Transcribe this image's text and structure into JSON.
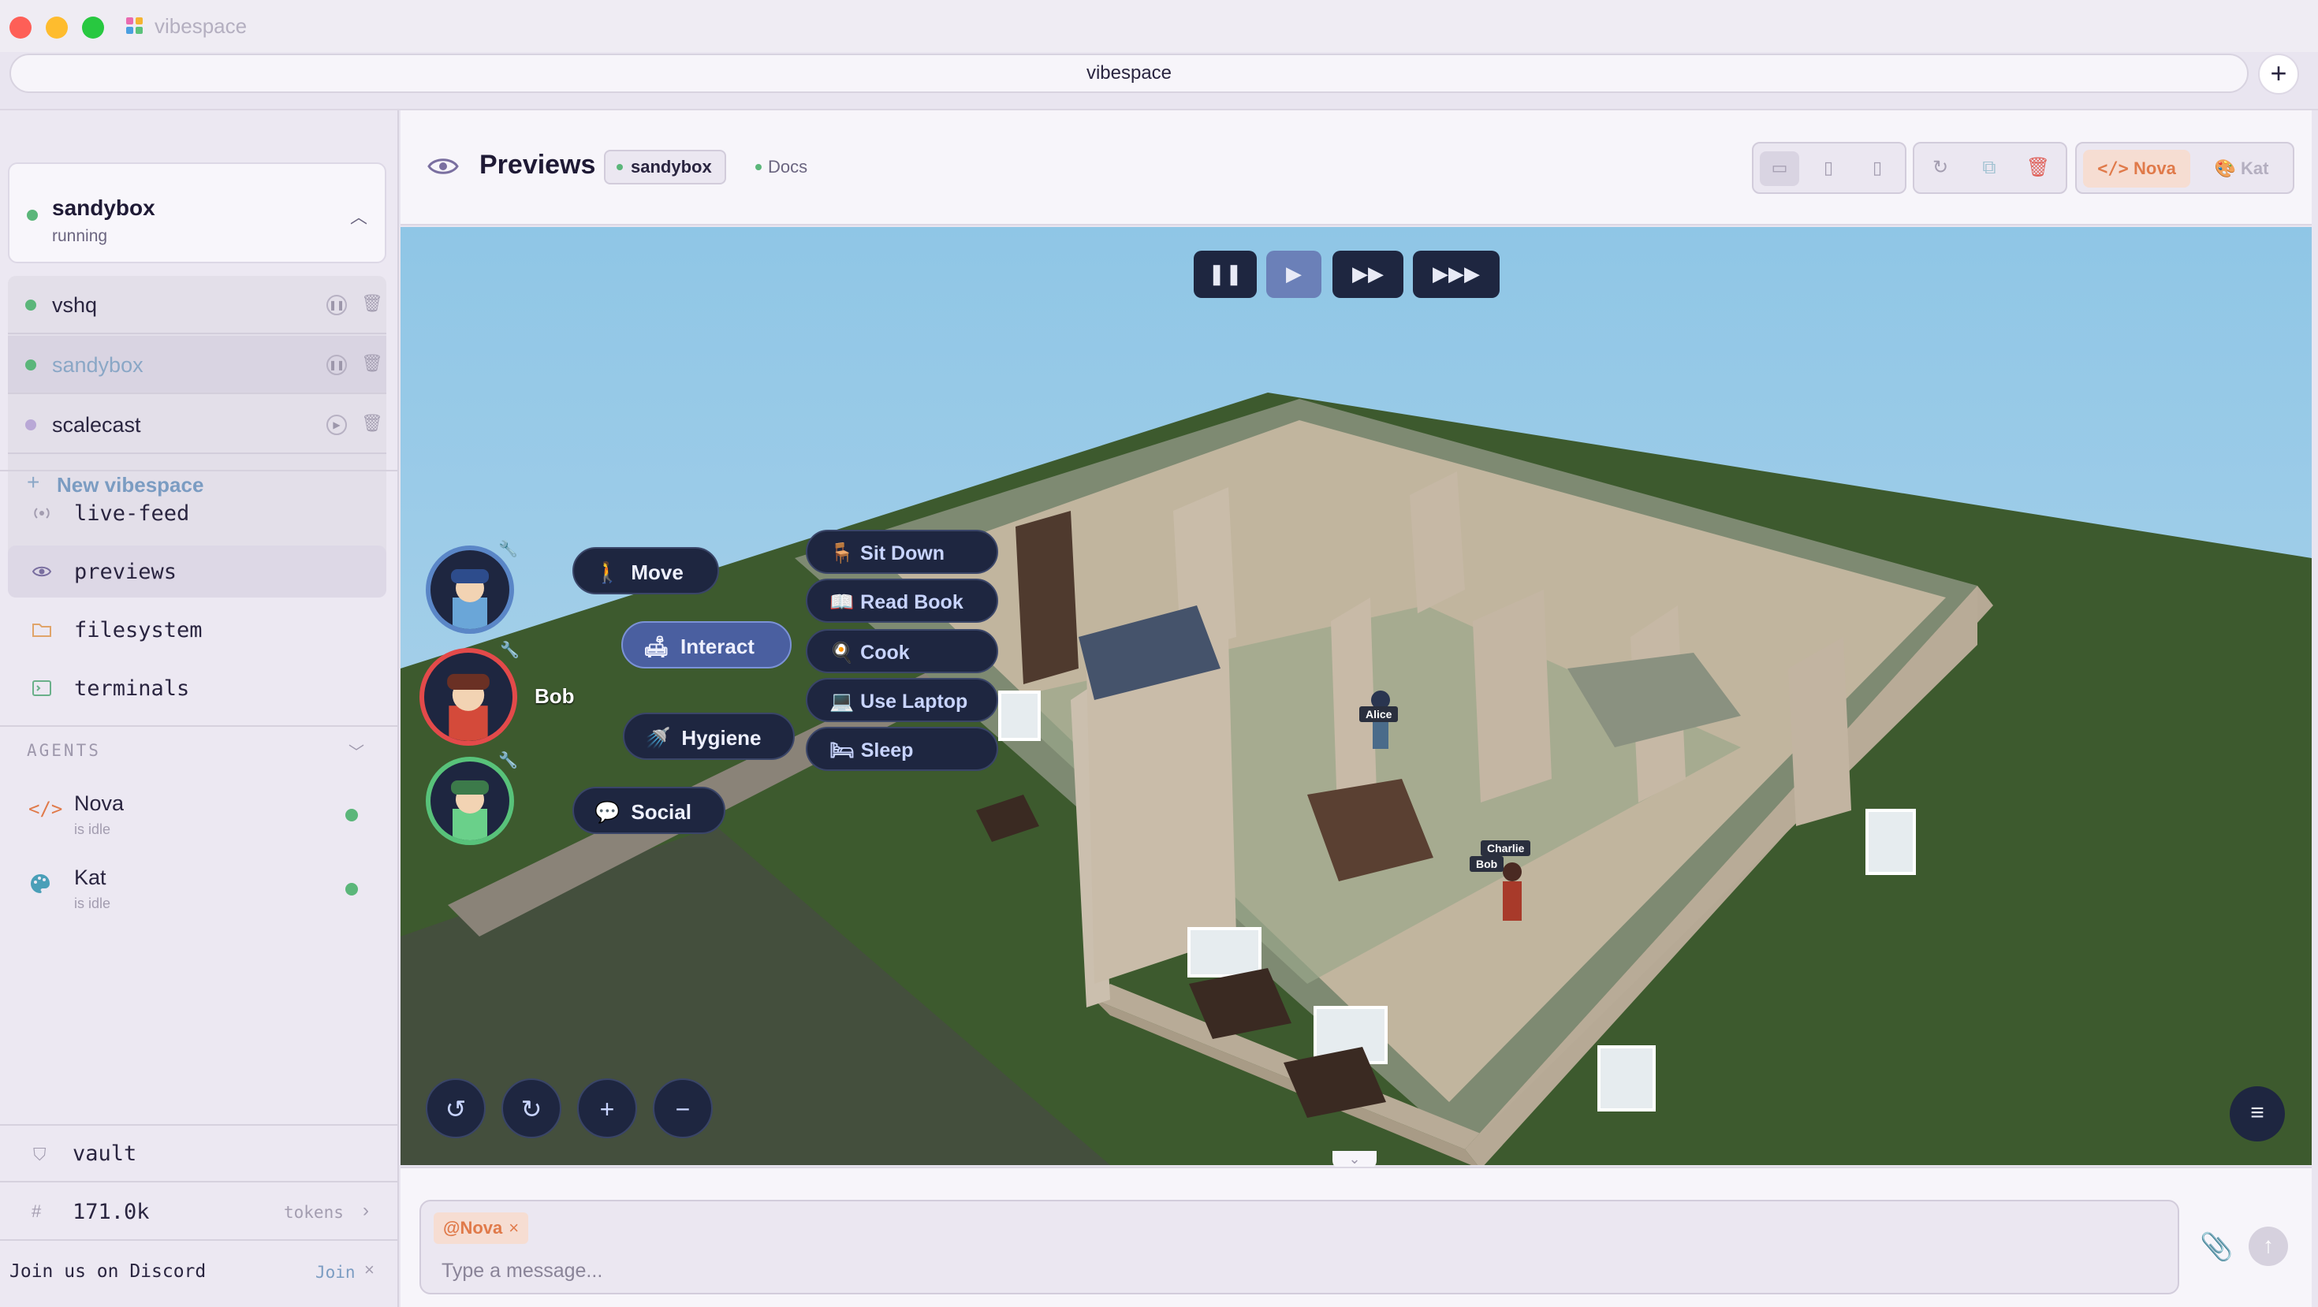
{
  "window": {
    "app_title": "vibespace",
    "url": "vibespace",
    "new_tab": "+"
  },
  "sidebar": {
    "current": {
      "name": "sandybox",
      "status": "running"
    },
    "workspaces": [
      {
        "name": "vshq",
        "control": "pause"
      },
      {
        "name": "sandybox",
        "control": "pause"
      },
      {
        "name": "scalecast",
        "control": "play"
      }
    ],
    "new_vibespace": "New vibespace",
    "nav": [
      {
        "label": "live-feed",
        "icon": "broadcast-icon"
      },
      {
        "label": "previews",
        "icon": "eye-icon"
      },
      {
        "label": "filesystem",
        "icon": "folder-icon"
      },
      {
        "label": "terminals",
        "icon": "terminal-icon"
      }
    ],
    "agents_header": "AGENTS",
    "agents": [
      {
        "name": "Nova",
        "status": "is idle",
        "icon": "code-icon",
        "color": "#e07a4a"
      },
      {
        "name": "Kat",
        "status": "is idle",
        "icon": "palette-icon",
        "color": "#4a9fb8"
      }
    ],
    "vault": "vault",
    "tokens": {
      "value": "171.0k",
      "label": "tokens"
    },
    "discord": {
      "text": "Join us on Discord",
      "join": "Join"
    }
  },
  "header": {
    "title": "Previews",
    "chips": [
      "sandybox",
      "Docs"
    ],
    "agent_switch": {
      "nova": "Nova",
      "kat": "Kat"
    }
  },
  "game": {
    "speeds": [
      "pause",
      "play",
      "fast",
      "fastest"
    ],
    "selected_character": "Bob",
    "actions": [
      {
        "label": "Move",
        "icon": "walk-icon"
      },
      {
        "label": "Interact",
        "icon": "sofa-icon"
      },
      {
        "label": "Hygiene",
        "icon": "shower-icon"
      },
      {
        "label": "Social",
        "icon": "speech-icon"
      }
    ],
    "interact_options": [
      {
        "label": "Sit Down",
        "icon": "chair-icon"
      },
      {
        "label": "Read Book",
        "icon": "book-icon"
      },
      {
        "label": "Cook",
        "icon": "pan-icon"
      },
      {
        "label": "Use Laptop",
        "icon": "laptop-icon"
      },
      {
        "label": "Sleep",
        "icon": "bed-icon"
      }
    ],
    "nametags": [
      "Alice",
      "Charlie",
      "Bob"
    ]
  },
  "composer": {
    "mention": "@Nova",
    "placeholder": "Type a message..."
  },
  "colors": {
    "accent": "#7b9cc2",
    "nova": "#e07a4a",
    "status_green": "#5bb67a",
    "game_ui": "#1e2640"
  }
}
